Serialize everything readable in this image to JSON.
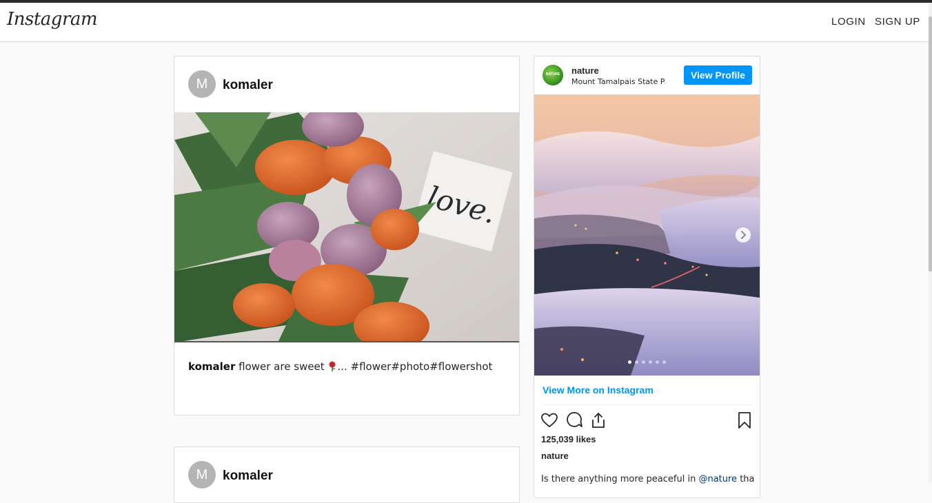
{
  "navbar": {
    "logo": "Instagram",
    "login": "LOGIN",
    "signup": "SIGN UP"
  },
  "posts": [
    {
      "avatar_letter": "M",
      "username": "komaler",
      "caption_user": "komaler",
      "caption_text": "flower are sweet",
      "caption_tags": "... #flower#photo#flowershot",
      "image": "orange and purple tulips bouquet with a love note card"
    },
    {
      "avatar_letter": "M",
      "username": "komaler"
    }
  ],
  "embed": {
    "avatar_text": "NATURE",
    "username": "nature",
    "location": "Mount Tamalpais State Pa",
    "view_profile": "View Profile",
    "image": "foggy valley at sunset with glowing city lights",
    "carousel_total": 6,
    "carousel_active": 1,
    "view_more": "View More on Instagram",
    "likes": "125,039 likes",
    "owner": "nature",
    "caption_start": "Is there anything more peaceful in ",
    "caption_mention": "@nature",
    "caption_end": " than"
  },
  "icons": {
    "heart": "heart-icon",
    "comment": "comment-icon",
    "share": "share-icon",
    "bookmark": "bookmark-icon",
    "next": "chevron-right-icon"
  },
  "colors": {
    "accent": "#0095f6",
    "background": "#fafafa",
    "border": "#dbdbdb",
    "avatar_gray": "#b4b4b4"
  }
}
